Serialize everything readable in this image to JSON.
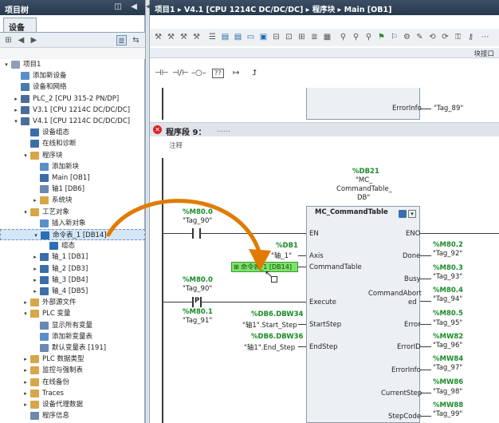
{
  "left_panel": {
    "title": "项目树",
    "controls": "◫ ◀",
    "tab": "设备",
    "tree": [
      {
        "label": "项目1",
        "level": 0
      },
      {
        "label": "添加新设备",
        "level": 1
      },
      {
        "label": "设备和网络",
        "level": 1
      },
      {
        "label": "PLC_2 [CPU 315-2 PN/DP]",
        "level": 1
      },
      {
        "label": "V3.1 [CPU 1214C DC/DC/DC]",
        "level": 1
      },
      {
        "label": "V4.1 [CPU 1214C DC/DC/DC]",
        "level": 1
      },
      {
        "label": "设备组态",
        "level": 2
      },
      {
        "label": "在线和诊断",
        "level": 2
      },
      {
        "label": "程序块",
        "level": 2
      },
      {
        "label": "添加新块",
        "level": 3
      },
      {
        "label": "Main [OB1]",
        "level": 3
      },
      {
        "label": "轴1 [DB6]",
        "level": 3
      },
      {
        "label": "系统块",
        "level": 3
      },
      {
        "label": "工艺对象",
        "level": 2
      },
      {
        "label": "插入新对象",
        "level": 3
      },
      {
        "label": "命令表_1 [DB14]",
        "level": 3
      },
      {
        "label": "组态",
        "level": 4
      },
      {
        "label": "轴_1 [DB1]",
        "level": 3
      },
      {
        "label": "轴_2 [DB3]",
        "level": 3
      },
      {
        "label": "轴_3 [DB4]",
        "level": 3
      },
      {
        "label": "轴_4 [DB5]",
        "level": 3
      },
      {
        "label": "外部源文件",
        "level": 2
      },
      {
        "label": "PLC 变量",
        "level": 2
      },
      {
        "label": "显示所有变量",
        "level": 3
      },
      {
        "label": "添加新变量表",
        "level": 3
      },
      {
        "label": "默认变量表 [191]",
        "level": 3
      },
      {
        "label": "PLC 数据类型",
        "level": 2
      },
      {
        "label": "监控与强制表",
        "level": 2
      },
      {
        "label": "在线备份",
        "level": 2
      },
      {
        "label": "Traces",
        "level": 2
      },
      {
        "label": "设备代理数据",
        "level": 2
      },
      {
        "label": "程序信息",
        "level": 2
      }
    ]
  },
  "breadcrumb": "项目1 ▸ V4.1 [CPU 1214C DC/DC/DC] ▸ 程序块 ▸ Main [OB1]",
  "block_interface_label": "块接口",
  "top_param": {
    "name": "ErrorInfo",
    "tag": "\"Tag_89\""
  },
  "network": {
    "title": "程序段 9：",
    "ellipsis": "……",
    "comment": "注释"
  },
  "fb": {
    "db_addr": "%DB21",
    "db_name_1": "\"MC_",
    "db_name_2": "CommandTable_",
    "db_name_3": "DB\"",
    "title": "MC_CommandTable",
    "en": "EN",
    "eno": "ENO",
    "inputs": [
      {
        "pin": "Axis",
        "addr": "%DB1",
        "tag": "\"轴_1\""
      },
      {
        "pin": "CommandTable",
        "addr": "",
        "tag": ""
      },
      {
        "pin": "Execute",
        "addr": "",
        "tag": ""
      },
      {
        "pin": "StartStep",
        "addr": "%DB6.DBW34",
        "tag": "\"轴1\".Start_Step"
      },
      {
        "pin": "EndStep",
        "addr": "%DB6.DBW36",
        "tag": "\"轴1\".End_Step"
      }
    ],
    "outputs": [
      {
        "pin": "Done",
        "addr": "%M80.2",
        "tag": "\"Tag_92\""
      },
      {
        "pin": "Busy",
        "addr": "%M80.3",
        "tag": "\"Tag_93\""
      },
      {
        "pin": "CommandAbort",
        "pin2": "ed",
        "addr": "%M80.4",
        "tag": "\"Tag_94\""
      },
      {
        "pin": "Error",
        "addr": "%M80.5",
        "tag": "\"Tag_95\""
      },
      {
        "pin": "ErrorID",
        "addr": "%MW82",
        "tag": "\"Tag_96\""
      },
      {
        "pin": "ErrorInfo",
        "addr": "%MW84",
        "tag": "\"Tag_97\""
      },
      {
        "pin": "CurrentStep",
        "addr": "%MW86",
        "tag": "\"Tag_98\""
      },
      {
        "pin": "StepCode",
        "addr": "%MW88",
        "tag": "\"Tag_99\""
      }
    ]
  },
  "contact1": {
    "addr": "%M80.0",
    "tag": "\"Tag_90\""
  },
  "contact2": {
    "addr": "%M80.0",
    "tag": "\"Tag_90\"",
    "symbol": "P"
  },
  "contact3": {
    "addr": "%M80.1",
    "tag": "\"Tag_91\""
  },
  "drag_tag": "命令表_1 [DB14]",
  "colors": {
    "accent": "#e07b00",
    "header": "#2f4257",
    "drag": "#7be36b"
  }
}
